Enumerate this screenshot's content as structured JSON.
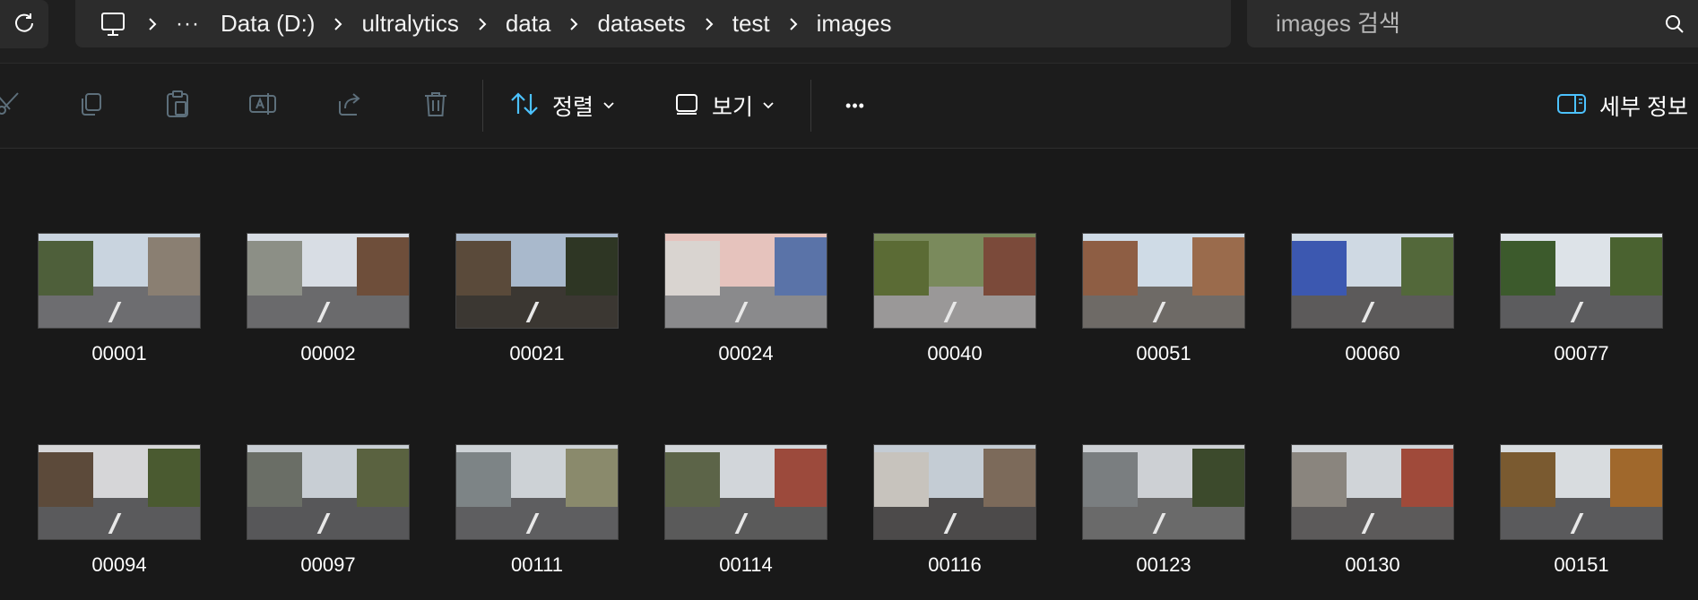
{
  "address_bar": {
    "refresh_icon": "refresh-icon",
    "pc_icon": "this-pc-icon",
    "overflow": "···",
    "breadcrumbs": [
      "Data (D:)",
      "ultralytics",
      "data",
      "datasets",
      "test",
      "images"
    ]
  },
  "search": {
    "placeholder": "images 검색",
    "icon": "search-icon"
  },
  "toolbar": {
    "cut_icon": "cut-icon",
    "copy_icon": "copy-icon",
    "paste_icon": "paste-icon",
    "rename_icon": "rename-icon",
    "share_icon": "share-icon",
    "delete_icon": "delete-icon",
    "sort_label": "정렬",
    "view_label": "보기",
    "more_label": "•••",
    "details_label": "세부 정보"
  },
  "colors": {
    "accent": "#4cc2ff",
    "background": "#191919",
    "disabled_icon": "#5d6f7b"
  },
  "files": [
    {
      "name": "00001",
      "sky": "#c9d4df",
      "ground": "#6d6d70",
      "left": "#4e5f3a",
      "right": "#8a7f72"
    },
    {
      "name": "00002",
      "sky": "#d8dde4",
      "ground": "#6a6a6c",
      "left": "#8c8f86",
      "right": "#6e4e3a"
    },
    {
      "name": "00021",
      "sky": "#a9b9cc",
      "ground": "#3b3732",
      "left": "#5a4a3a",
      "right": "#2e3624"
    },
    {
      "name": "00024",
      "sky": "#e6c3bd",
      "ground": "#8a8a8c",
      "left": "#d9d4d0",
      "right": "#5a73a8"
    },
    {
      "name": "00040",
      "sky": "#7a8a5c",
      "ground": "#9a9898",
      "left": "#5b6b35",
      "right": "#7b4a3a"
    },
    {
      "name": "00051",
      "sky": "#cfdbe6",
      "ground": "#6e6a66",
      "left": "#8e5e44",
      "right": "#9a6b4c"
    },
    {
      "name": "00060",
      "sky": "#cfd9e3",
      "ground": "#5c5a5a",
      "left": "#3c58b0",
      "right": "#53683a"
    },
    {
      "name": "00077",
      "sky": "#dde3e8",
      "ground": "#5c5c5e",
      "left": "#3c5a2c",
      "right": "#4a6230"
    },
    {
      "name": "00094",
      "sky": "#d6d6d8",
      "ground": "#5a5a5c",
      "left": "#5c4a3a",
      "right": "#4a5a30"
    },
    {
      "name": "00097",
      "sky": "#c8ced4",
      "ground": "#575759",
      "left": "#6a6e66",
      "right": "#5a6240"
    },
    {
      "name": "00111",
      "sky": "#cdd2d6",
      "ground": "#5e5e60",
      "left": "#7d8486",
      "right": "#8a8a6c"
    },
    {
      "name": "00114",
      "sky": "#d2d6da",
      "ground": "#5a5a5a",
      "left": "#5c6448",
      "right": "#9c4a3c"
    },
    {
      "name": "00116",
      "sky": "#c4ccd4",
      "ground": "#4c4a4a",
      "left": "#c7c3bd",
      "right": "#7c6a5a"
    },
    {
      "name": "00123",
      "sky": "#cdd0d4",
      "ground": "#6a6a6a",
      "left": "#7a7e80",
      "right": "#3c4a2c"
    },
    {
      "name": "00130",
      "sky": "#d0d4d8",
      "ground": "#5c5a5a",
      "left": "#8a857e",
      "right": "#a04a3a"
    },
    {
      "name": "00151",
      "sky": "#d8dcdf",
      "ground": "#5a5a5c",
      "left": "#7a5a30",
      "right": "#a0682c"
    }
  ]
}
